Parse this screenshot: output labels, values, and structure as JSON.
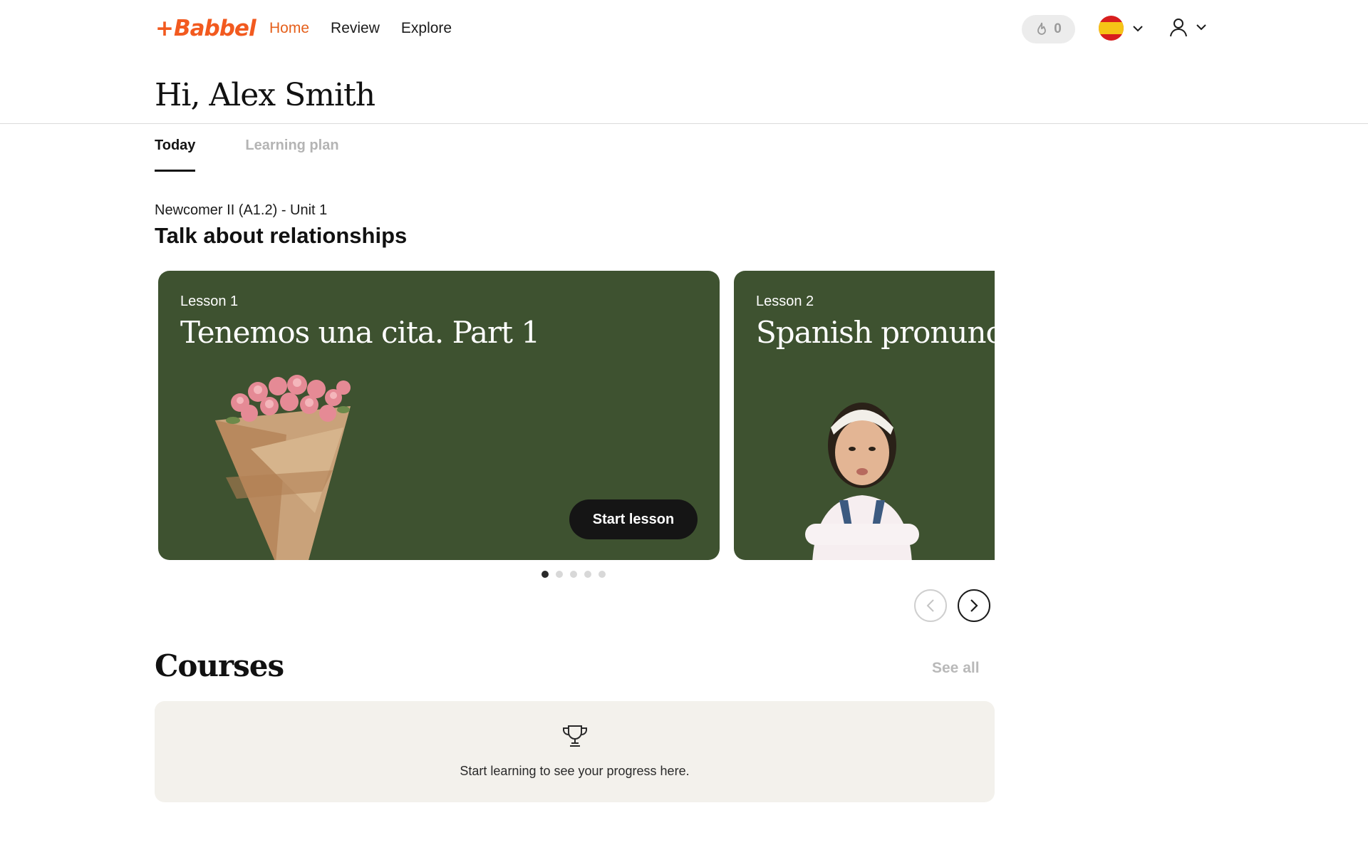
{
  "header": {
    "logo": "Babbel",
    "nav": [
      {
        "label": "Home",
        "active": true
      },
      {
        "label": "Review",
        "active": false
      },
      {
        "label": "Explore",
        "active": false
      }
    ],
    "streak_count": "0",
    "language_flag": "spanish-flag-icon",
    "colors": {
      "brand": "#f25a1f",
      "active_nav": "#e5601c"
    }
  },
  "greeting": "Hi, Alex Smith",
  "tabs": [
    {
      "label": "Today",
      "active": true
    },
    {
      "label": "Learning plan",
      "active": false
    }
  ],
  "unit": {
    "subtitle": "Newcomer II (A1.2) - Unit 1",
    "title": "Talk about relationships"
  },
  "lessons": [
    {
      "number": "Lesson 1",
      "title": "Tenemos una cita. Part 1",
      "button": "Start lesson",
      "image": "flower-bouquet"
    },
    {
      "number": "Lesson 2",
      "title": "Spanish pronunciation",
      "image": "girl-arms-crossed"
    }
  ],
  "carousel": {
    "dots": 5,
    "active_dot": 1
  },
  "colors": {
    "card_bg": "#3e5230",
    "button_bg": "#151515",
    "courses_bg": "#f3f1ec"
  },
  "courses": {
    "title": "Courses",
    "see_all": "See all",
    "empty_message": "Start learning to see your progress here."
  }
}
